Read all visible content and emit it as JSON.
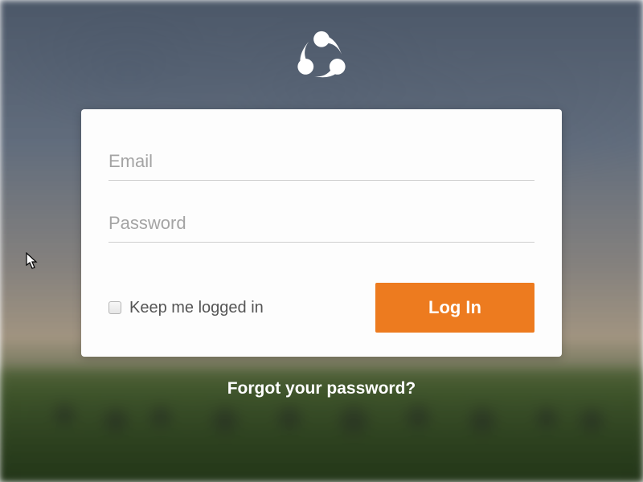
{
  "form": {
    "email": {
      "placeholder": "Email",
      "value": ""
    },
    "password": {
      "placeholder": "Password",
      "value": ""
    },
    "remember_label": "Keep me logged in",
    "submit_label": "Log In"
  },
  "forgot_link": "Forgot your password?",
  "colors": {
    "accent": "#ed7b1f"
  }
}
